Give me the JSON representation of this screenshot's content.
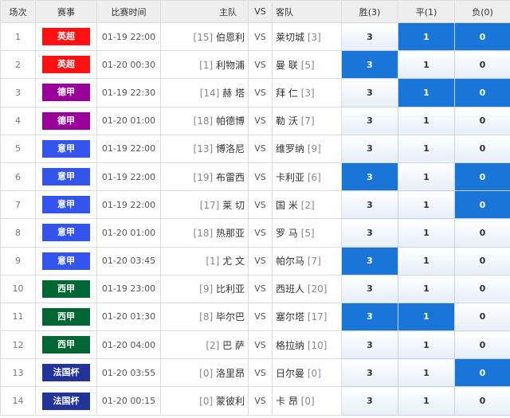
{
  "headers": {
    "index": "场次",
    "league": "赛事",
    "time": "比赛时间",
    "home": "主队",
    "vs": "VS",
    "away": "客队",
    "win": "胜(3)",
    "draw": "平(1)",
    "lose": "负(0)"
  },
  "colors": {
    "英超": "#ff1111",
    "德甲": "#990099",
    "意甲": "#3355ee",
    "西甲": "#006633",
    "法国杯": "#223399",
    "selected": "#1976d8"
  },
  "rows": [
    {
      "index": "1",
      "league": "英超",
      "time": "01-19 22:00",
      "home_rank": "[15]",
      "home": "伯恩利",
      "vs": "VS",
      "away": "莱切城",
      "away_rank": "[3]",
      "win": "3",
      "draw": "1",
      "lose": "0",
      "selected": [
        "draw",
        "lose"
      ]
    },
    {
      "index": "2",
      "league": "英超",
      "time": "01-20 00:30",
      "home_rank": "[1]",
      "home": "利物浦",
      "vs": "VS",
      "away": "曼 联",
      "away_rank": "[5]",
      "win": "3",
      "draw": "1",
      "lose": "0",
      "selected": [
        "win"
      ]
    },
    {
      "index": "3",
      "league": "德甲",
      "time": "01-19 22:30",
      "home_rank": "[14]",
      "home": "赫 塔",
      "vs": "VS",
      "away": "拜 仁",
      "away_rank": "[3]",
      "win": "3",
      "draw": "1",
      "lose": "0",
      "selected": [
        "draw",
        "lose"
      ]
    },
    {
      "index": "4",
      "league": "德甲",
      "time": "01-20 01:00",
      "home_rank": "[18]",
      "home": "帕德博",
      "vs": "VS",
      "away": "勒 沃",
      "away_rank": "[7]",
      "win": "3",
      "draw": "1",
      "lose": "0",
      "selected": []
    },
    {
      "index": "5",
      "league": "意甲",
      "time": "01-19 22:00",
      "home_rank": "[13]",
      "home": "博洛尼",
      "vs": "VS",
      "away": "维罗纳",
      "away_rank": "[9]",
      "win": "3",
      "draw": "1",
      "lose": "0",
      "selected": []
    },
    {
      "index": "6",
      "league": "意甲",
      "time": "01-19 22:00",
      "home_rank": "[19]",
      "home": "布雷西",
      "vs": "VS",
      "away": "卡利亚",
      "away_rank": "[6]",
      "win": "3",
      "draw": "1",
      "lose": "0",
      "selected": [
        "win",
        "lose"
      ]
    },
    {
      "index": "7",
      "league": "意甲",
      "time": "01-19 22:00",
      "home_rank": "[17]",
      "home": "莱 切",
      "vs": "VS",
      "away": "国 米",
      "away_rank": "[2]",
      "win": "3",
      "draw": "1",
      "lose": "0",
      "selected": [
        "lose"
      ]
    },
    {
      "index": "8",
      "league": "意甲",
      "time": "01-20 01:00",
      "home_rank": "[18]",
      "home": "热那亚",
      "vs": "VS",
      "away": "罗 马",
      "away_rank": "[5]",
      "win": "3",
      "draw": "1",
      "lose": "0",
      "selected": []
    },
    {
      "index": "9",
      "league": "意甲",
      "time": "01-20 03:45",
      "home_rank": "[1]",
      "home": "尤 文",
      "vs": "VS",
      "away": "帕尔马",
      "away_rank": "[7]",
      "win": "3",
      "draw": "1",
      "lose": "0",
      "selected": [
        "win"
      ]
    },
    {
      "index": "10",
      "league": "西甲",
      "time": "01-19 23:00",
      "home_rank": "[9]",
      "home": "比利亚",
      "vs": "VS",
      "away": "西班人",
      "away_rank": "[20]",
      "win": "3",
      "draw": "1",
      "lose": "0",
      "selected": []
    },
    {
      "index": "11",
      "league": "西甲",
      "time": "01-20 01:30",
      "home_rank": "[8]",
      "home": "毕尔巴",
      "vs": "VS",
      "away": "塞尔塔",
      "away_rank": "[17]",
      "win": "3",
      "draw": "1",
      "lose": "0",
      "selected": [
        "win",
        "draw"
      ]
    },
    {
      "index": "12",
      "league": "西甲",
      "time": "01-20 04:00",
      "home_rank": "[2]",
      "home": "巴 萨",
      "vs": "VS",
      "away": "格拉纳",
      "away_rank": "[10]",
      "win": "3",
      "draw": "1",
      "lose": "0",
      "selected": []
    },
    {
      "index": "13",
      "league": "法国杯",
      "time": "01-20 03:55",
      "home_rank": "[0]",
      "home": "洛里昂",
      "vs": "VS",
      "away": "日尔曼",
      "away_rank": "[0]",
      "win": "3",
      "draw": "1",
      "lose": "0",
      "selected": [
        "lose"
      ]
    },
    {
      "index": "14",
      "league": "法国杯",
      "time": "01-20 00:15",
      "home_rank": "[0]",
      "home": "蒙彼利",
      "vs": "VS",
      "away": "卡 昂",
      "away_rank": "[0]",
      "win": "3",
      "draw": "1",
      "lose": "0",
      "selected": []
    }
  ]
}
